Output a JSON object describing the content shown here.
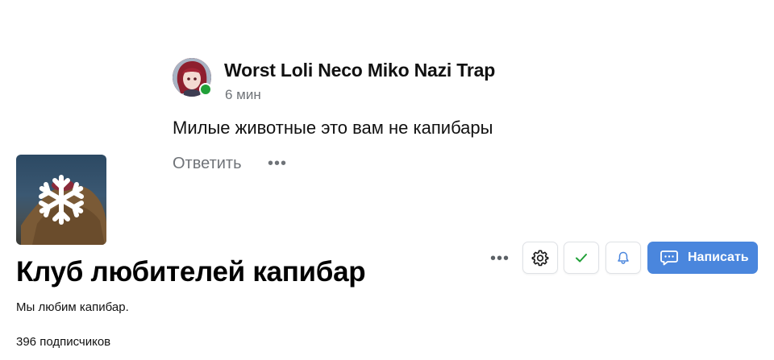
{
  "comment": {
    "author": "Worst Loli Neco Miko Nazi Trap",
    "time": "6 мин",
    "text": "Милые животные это вам не капибары",
    "reply_label": "Ответить",
    "more_label": "•••",
    "online": true,
    "online_color": "#21a038"
  },
  "club": {
    "title": "Клуб любителей капибар",
    "description": "Мы любим капибар.",
    "subscribers": "396 подписчиков",
    "avatar_icon": "snowflake-icon"
  },
  "actions": {
    "more_label": "•••",
    "settings_icon": "gear-icon",
    "check_icon": "check-icon",
    "bell_icon": "bell-icon",
    "write_label": "Написать",
    "write_icon": "message-icon",
    "accent_color": "#4a86dd",
    "check_color": "#21a038"
  }
}
